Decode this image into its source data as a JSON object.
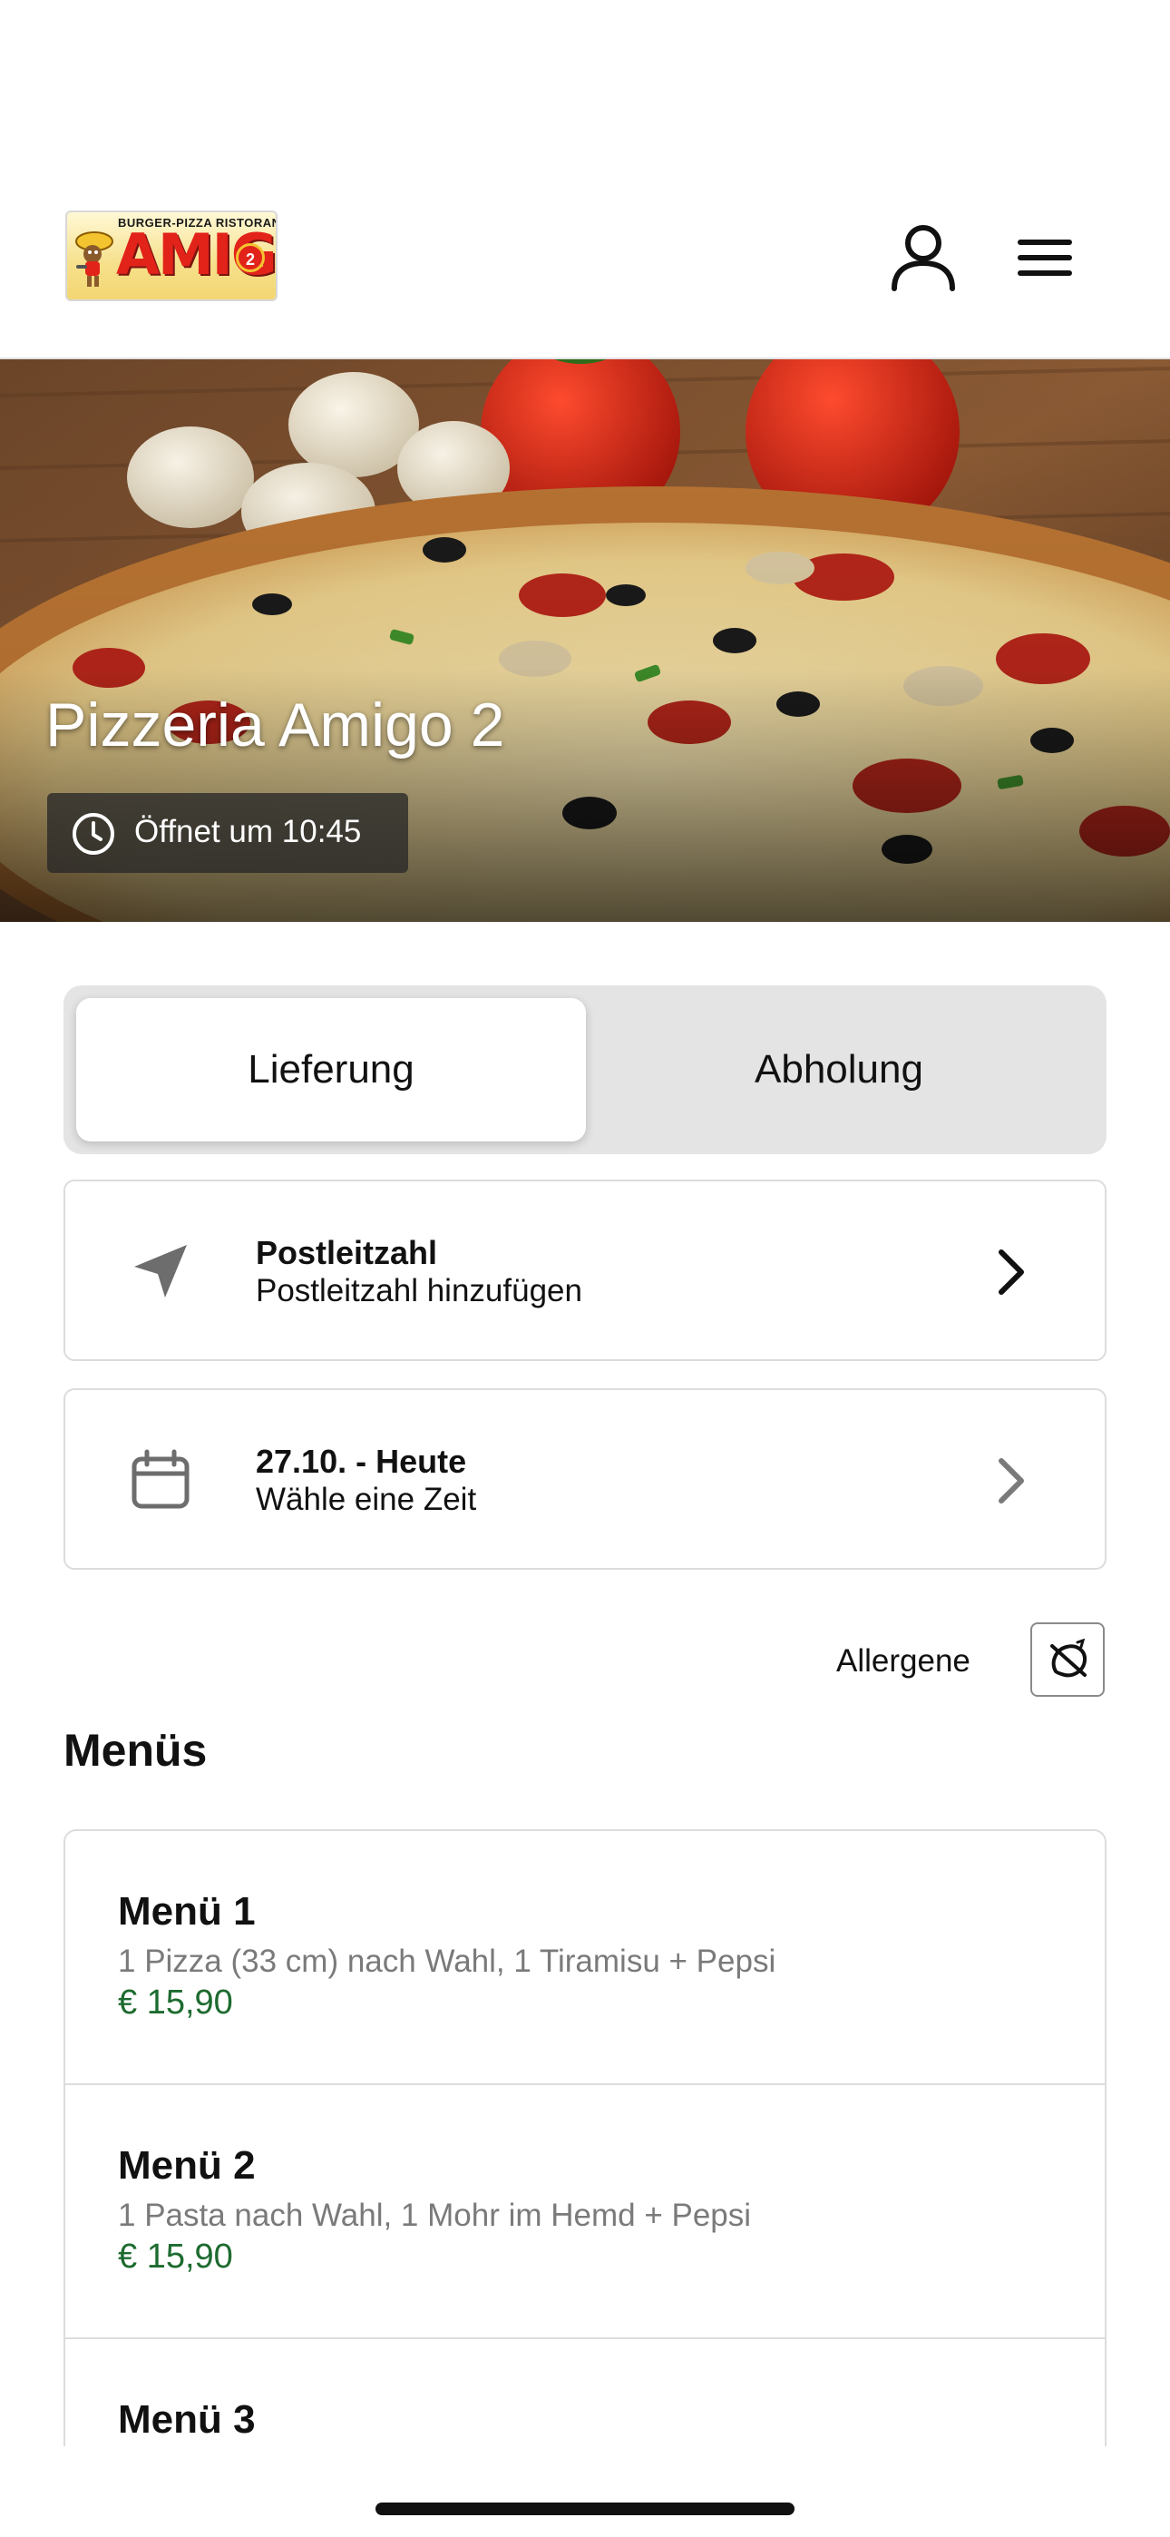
{
  "header": {
    "logo": {
      "top_text": "BURGER-PIZZA RISTORANTE",
      "main_text": "AMIGO",
      "badge_text": "2"
    },
    "icons": {
      "account": "user-icon",
      "menu": "hamburger-menu-icon"
    }
  },
  "hero": {
    "title": "Pizzeria Amigo 2",
    "hours": "Öffnet um 10:45",
    "hours_icon": "clock-icon"
  },
  "order_mode": {
    "options": [
      "Lieferung",
      "Abholung"
    ],
    "selected": "Lieferung"
  },
  "postcode_card": {
    "icon": "location-arrow-icon",
    "title": "Postleitzahl",
    "subtitle": "Postleitzahl hinzufügen"
  },
  "time_card": {
    "icon": "calendar-icon",
    "title": "27.10. - Heute",
    "subtitle": "Wähle eine Zeit"
  },
  "allergens": {
    "label": "Allergene",
    "icon": "allergen-filter-icon"
  },
  "menus": {
    "heading": "Menüs",
    "items": [
      {
        "name": "Menü 1",
        "description": "1 Pizza (33 cm) nach Wahl, 1 Tiramisu + Pepsi",
        "price": "€ 15,90"
      },
      {
        "name": "Menü 2",
        "description": "1 Pasta nach Wahl, 1 Mohr im Hemd + Pepsi",
        "price": "€ 15,90"
      },
      {
        "name": "Menü 3",
        "description": "",
        "price": ""
      }
    ]
  },
  "colors": {
    "price": "#1d6b2f",
    "brand_red": "#e2231a",
    "segment_bg": "#e4e4e4"
  }
}
